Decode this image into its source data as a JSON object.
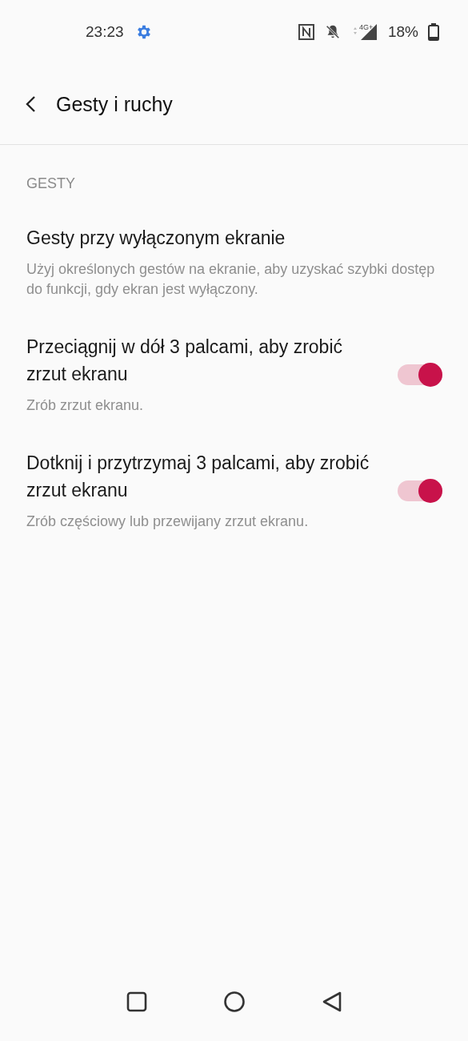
{
  "status_bar": {
    "time": "23:23",
    "network_type": "4G+",
    "battery": "18%"
  },
  "header": {
    "title": "Gesty i ruchy"
  },
  "section": {
    "title": "GESTY"
  },
  "items": [
    {
      "kind": "link",
      "title": "Gesty przy wyłączonym ekranie",
      "subtitle": "Użyj określonych gestów na ekranie, aby uzyskać szybki dostęp do funkcji, gdy ekran jest wyłączony."
    },
    {
      "kind": "switch",
      "title": "Przeciągnij w dół 3 palcami, aby zrobić zrzut ekranu",
      "subtitle": "Zrób zrzut ekranu.",
      "on": true
    },
    {
      "kind": "switch",
      "title": "Dotknij i przytrzymaj 3 palcami, aby zrobić zrzut ekranu",
      "subtitle": "Zrób częściowy lub przewijany zrzut ekranu.",
      "on": true
    }
  ]
}
